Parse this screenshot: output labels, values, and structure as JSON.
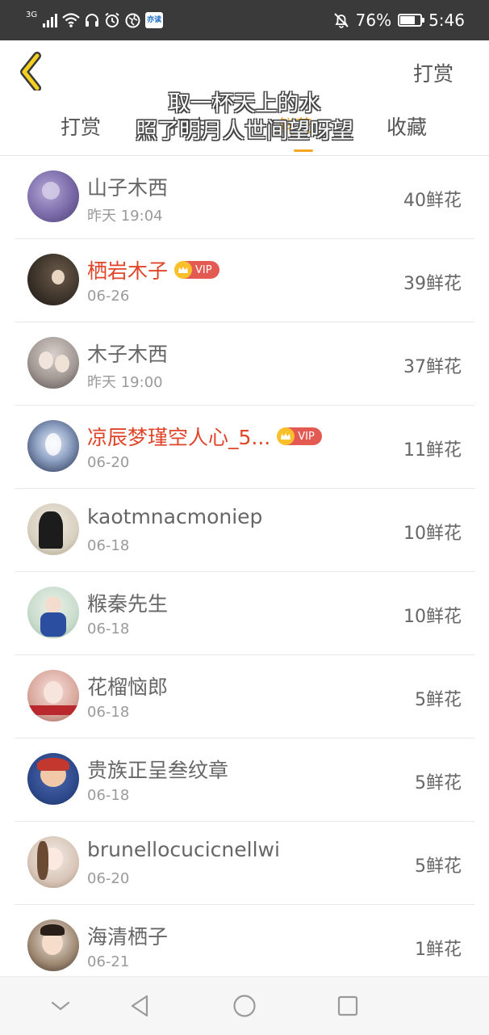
{
  "status_bar": {
    "network": "3G",
    "app_icon_label": "亦读",
    "battery_percent": 76,
    "battery_text": "76%",
    "time": "5:46",
    "left_icons": [
      "signal-icon",
      "wifi-icon",
      "headphones-icon",
      "alarm-icon",
      "globe-icon",
      "app-icon"
    ],
    "right_icons": [
      "do-not-disturb-icon",
      "battery-icon"
    ]
  },
  "header": {
    "back_icon": "chevron-left-icon",
    "action_label": "打赏",
    "tabs": [
      "打赏",
      "打卡",
      "鲜花",
      "收藏"
    ],
    "active_tab": "鲜花",
    "accent_color": "#f5a623"
  },
  "overlay_text": {
    "line1": "取一杯天上的水",
    "line2": "照了明月人世间望呀望"
  },
  "list": {
    "items": [
      {
        "name": "山子木西",
        "date": "昨天 19:04",
        "count": "40鲜花",
        "vip": false
      },
      {
        "name": "栖岩木子",
        "date": "06-26",
        "count": "39鲜花",
        "vip": true,
        "badge": "VIP"
      },
      {
        "name": "木子木西",
        "date": "昨天 19:00",
        "count": "37鲜花",
        "vip": false
      },
      {
        "name": "凉辰梦瑾空人心_5...",
        "date": "06-20",
        "count": "11鲜花",
        "vip": true,
        "badge": "VIP"
      },
      {
        "name": "kaotmnacmoniep",
        "date": "06-18",
        "count": "10鲜花",
        "vip": false
      },
      {
        "name": "糇秦先生",
        "date": "06-18",
        "count": "10鲜花",
        "vip": false
      },
      {
        "name": "花榴恼郎",
        "date": "06-18",
        "count": "5鲜花",
        "vip": false
      },
      {
        "name": "贵族正呈叁纹章",
        "date": "06-18",
        "count": "5鲜花",
        "vip": false
      },
      {
        "name": "brunellocucicnellwi",
        "date": "06-20",
        "count": "5鲜花",
        "vip": false
      },
      {
        "name": "海清栖子",
        "date": "06-21",
        "count": "1鲜花",
        "vip": false
      }
    ]
  },
  "nav_bar": {
    "buttons": [
      "chevron-down-icon",
      "back-triangle-icon",
      "home-circle-icon",
      "recents-square-icon"
    ]
  }
}
